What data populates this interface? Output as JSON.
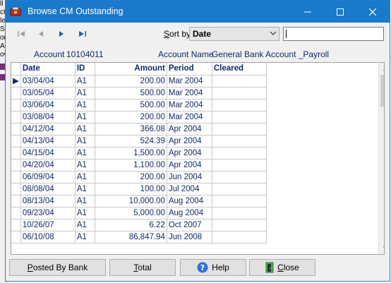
{
  "background": {
    "fragments": [
      "ll",
      "ct",
      "le",
      "S",
      "or",
      "Ac",
      "ov"
    ]
  },
  "window": {
    "title": "Browse CM Outstanding",
    "title_bar_color": "#1979ca"
  },
  "toolbar": {
    "sort_label_prefix": "S",
    "sort_label_rest": "ort by",
    "sort_value": "Date",
    "search_value": ""
  },
  "account": {
    "label": "Account",
    "number": "10104011",
    "name_label": "Account Name",
    "name": "General Bank Account _Payroll"
  },
  "table": {
    "headers": {
      "date": "Date",
      "id": "ID",
      "amount": "Amount",
      "period": "Period",
      "cleared": "Cleared"
    },
    "current_row_indicator": "▶",
    "rows": [
      {
        "date": "03/04/04",
        "id": "A1",
        "amount": "200.00",
        "period": "Mar 2004",
        "cleared": ""
      },
      {
        "date": "03/05/04",
        "id": "A1",
        "amount": "500.00",
        "period": "Mar 2004",
        "cleared": ""
      },
      {
        "date": "03/06/04",
        "id": "A1",
        "amount": "500.00",
        "period": "Mar 2004",
        "cleared": ""
      },
      {
        "date": "03/08/04",
        "id": "A1",
        "amount": "200.00",
        "period": "Mar 2004",
        "cleared": ""
      },
      {
        "date": "04/12/04",
        "id": "A1",
        "amount": "366.08",
        "period": "Apr 2004",
        "cleared": ""
      },
      {
        "date": "04/13/04",
        "id": "A1",
        "amount": "524.39",
        "period": "Apr 2004",
        "cleared": ""
      },
      {
        "date": "04/15/04",
        "id": "A1",
        "amount": "1,500.00",
        "period": "Apr 2004",
        "cleared": ""
      },
      {
        "date": "04/20/04",
        "id": "A1",
        "amount": "1,100.00",
        "period": "Apr 2004",
        "cleared": ""
      },
      {
        "date": "06/09/04",
        "id": "A1",
        "amount": "200.00",
        "period": "Jun 2004",
        "cleared": ""
      },
      {
        "date": "08/08/04",
        "id": "A1",
        "amount": "100.00",
        "period": "Jul 2004",
        "cleared": ""
      },
      {
        "date": "08/13/04",
        "id": "A1",
        "amount": "10,000.00",
        "period": "Aug 2004",
        "cleared": ""
      },
      {
        "date": "09/23/04",
        "id": "A1",
        "amount": "5,000.00",
        "period": "Aug 2004",
        "cleared": ""
      },
      {
        "date": "10/26/07",
        "id": "A1",
        "amount": "6.22",
        "period": "Oct 2007",
        "cleared": ""
      },
      {
        "date": "06/10/08",
        "id": "A1",
        "amount": "86,847.94",
        "period": "Jun 2008",
        "cleared": ""
      }
    ]
  },
  "buttons": {
    "posted_prefix": "P",
    "posted_rest": "osted By Bank",
    "total_prefix": "T",
    "total_rest": "otal",
    "help": "Help",
    "close_prefix": "C",
    "close_rest": "lose"
  }
}
